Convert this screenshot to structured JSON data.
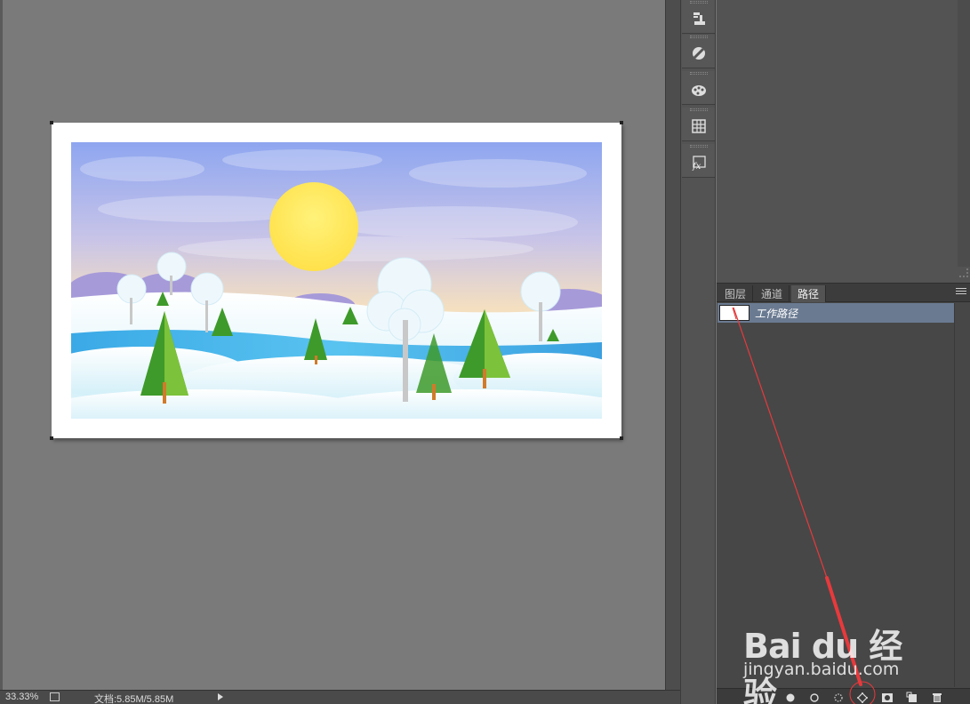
{
  "status_bar": {
    "zoom": "33.33%",
    "doc_info": "文档:5.85M/5.85M"
  },
  "panel": {
    "tabs": [
      {
        "label": "图层",
        "active": false
      },
      {
        "label": "通道",
        "active": false
      },
      {
        "label": "路径",
        "active": true
      }
    ],
    "paths": [
      {
        "name": "工作路径",
        "selected": true
      }
    ],
    "footer_buttons": [
      "fill-path-icon",
      "stroke-path-icon",
      "load-as-selection-icon",
      "make-work-path-icon",
      "add-mask-icon",
      "new-path-icon",
      "delete-path-icon"
    ]
  },
  "toolstrip": [
    "clone-source-icon",
    "adjustments-icon",
    "swatches-icon",
    "grid-icon",
    "styles-fx-icon"
  ],
  "watermark": {
    "brand": "Bai du 经验",
    "url": "jingyan.baidu.com"
  },
  "colors": {
    "annotation_red": "#e8393c",
    "selected_row": "#6a7a91"
  }
}
